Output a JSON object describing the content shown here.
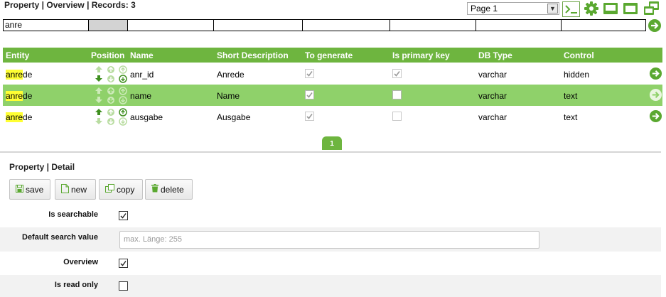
{
  "header": {
    "title": "Property | Overview | Records: 3",
    "page_select": "Page 1",
    "icons": [
      "console-icon",
      "gear-icon",
      "maximize-icon",
      "window-icon",
      "restore-icon"
    ]
  },
  "filter": {
    "values": [
      "anre",
      "",
      "",
      "",
      "",
      "",
      "",
      ""
    ]
  },
  "grid": {
    "columns": [
      "Entity",
      "Position",
      "Name",
      "Short Description",
      "To generate",
      "Is primary key",
      "DB Type",
      "Control"
    ],
    "rows": [
      {
        "entity_hl": "anre",
        "entity_rest": "de",
        "name": "anr_id",
        "short_description": "Anrede",
        "to_generate": true,
        "is_primary_key": true,
        "db_type": "varchar",
        "control": "hidden"
      },
      {
        "entity_hl": "anre",
        "entity_rest": "de",
        "name": "name",
        "short_description": "Name",
        "to_generate": true,
        "is_primary_key": false,
        "db_type": "varchar",
        "control": "text"
      },
      {
        "entity_hl": "anre",
        "entity_rest": "de",
        "name": "ausgabe",
        "short_description": "Ausgabe",
        "to_generate": true,
        "is_primary_key": false,
        "db_type": "varchar",
        "control": "text"
      }
    ],
    "selected_row": 1
  },
  "pager": {
    "page": "1"
  },
  "detail": {
    "title": "Property | Detail",
    "buttons": {
      "save": "save",
      "new": "new",
      "copy": "copy",
      "delete": "delete"
    },
    "fields": {
      "is_searchable": {
        "label": "Is searchable",
        "checked": true
      },
      "default_search_value": {
        "label": "Default search value",
        "placeholder": "max. Länge: 255",
        "value": ""
      },
      "overview": {
        "label": "Overview",
        "checked": true
      },
      "is_read_only": {
        "label": "Is read only",
        "checked": false
      }
    }
  },
  "colors": {
    "accent_green": "#6eb53f",
    "selected_row": "#8fd16a",
    "highlight": "#ffff33",
    "icon_green": "#5aa830"
  }
}
